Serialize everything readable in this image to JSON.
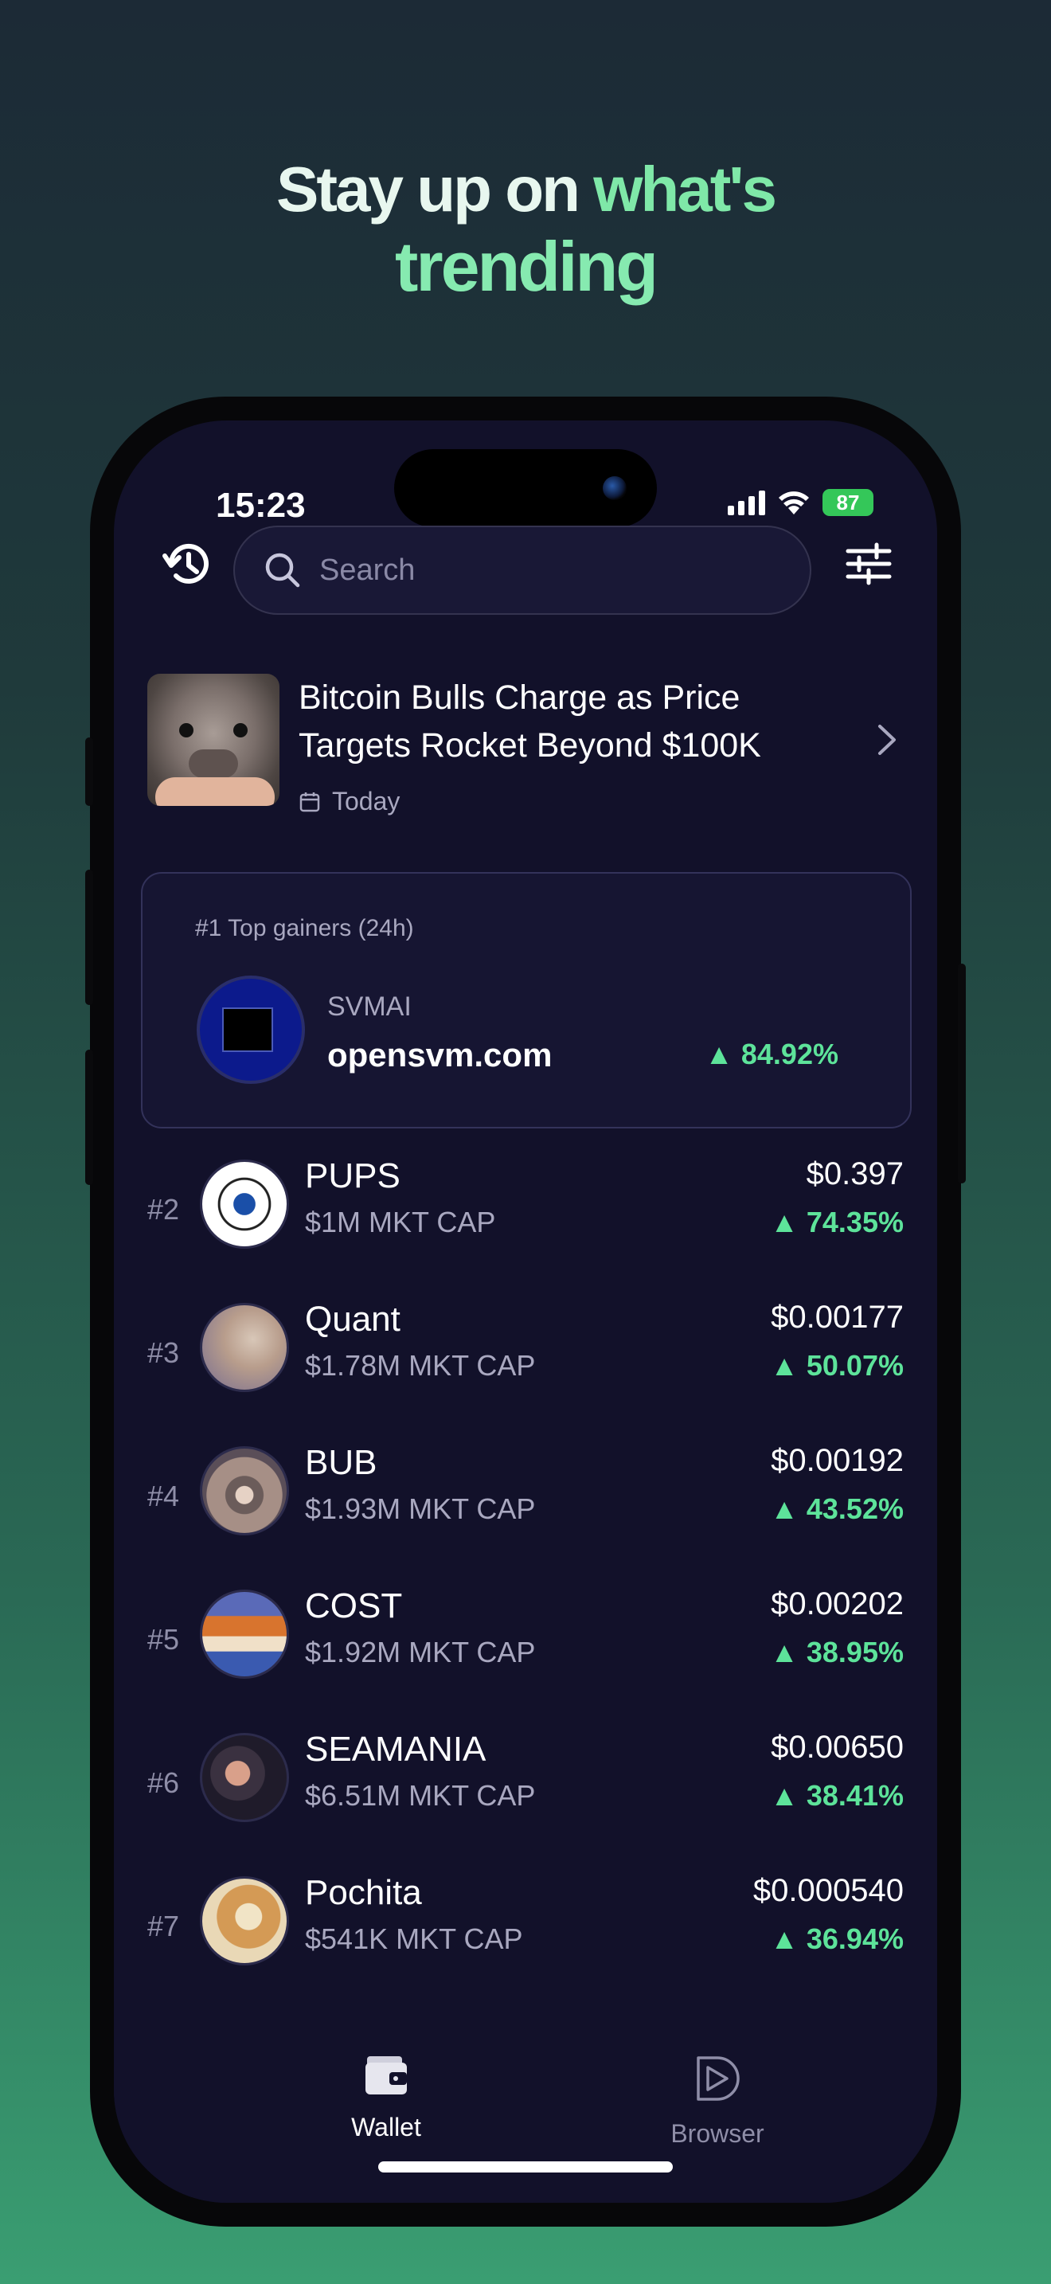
{
  "headline": {
    "line1_a": "Stay up on ",
    "line1_b": "what's",
    "line2": "trending"
  },
  "status_bar": {
    "time": "15:23",
    "battery": "87"
  },
  "search": {
    "placeholder": "Search"
  },
  "news": {
    "title": "Bitcoin Bulls Charge as Price Targets Rocket Beyond $100K",
    "date": "Today"
  },
  "top_gainer": {
    "label": "#1 Top gainers (24h)",
    "symbol": "SVMAI",
    "name": "opensvm.com",
    "change": "84.92%"
  },
  "tokens": [
    {
      "rank": "#2",
      "name": "PUPS",
      "cap": "$1M MKT CAP",
      "price": "$0.397",
      "change": "74.35%"
    },
    {
      "rank": "#3",
      "name": "Quant",
      "cap": "$1.78M MKT CAP",
      "price": "$0.00177",
      "change": "50.07%"
    },
    {
      "rank": "#4",
      "name": "BUB",
      "cap": "$1.93M MKT CAP",
      "price": "$0.00192",
      "change": "43.52%"
    },
    {
      "rank": "#5",
      "name": "COST",
      "cap": "$1.92M MKT CAP",
      "price": "$0.00202",
      "change": "38.95%"
    },
    {
      "rank": "#6",
      "name": "SEAMANIA",
      "cap": "$6.51M MKT CAP",
      "price": "$0.00650",
      "change": "38.41%"
    },
    {
      "rank": "#7",
      "name": "Pochita",
      "cap": "$541K MKT CAP",
      "price": "$0.000540",
      "change": "36.94%"
    }
  ],
  "tabs": {
    "wallet": "Wallet",
    "browser": "Browser"
  },
  "colors": {
    "accent_green": "#5de39a",
    "screen_bg": "#12112a"
  }
}
